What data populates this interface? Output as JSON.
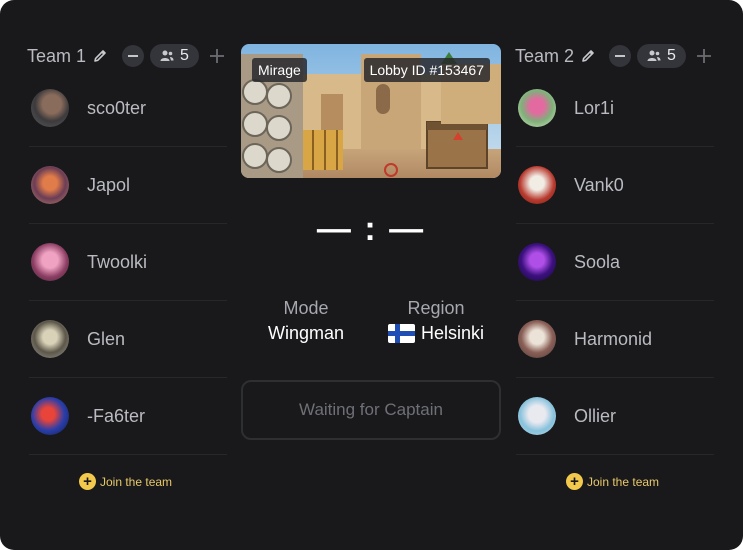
{
  "team1": {
    "title": "Team 1",
    "count": "5",
    "players": [
      "sco0ter",
      "Japol",
      "Twoolki",
      "Glen",
      "-Fa6ter"
    ],
    "join_label": "Join the team"
  },
  "team2": {
    "title": "Team 2",
    "count": "5",
    "players": [
      "Lor1i",
      "Vank0",
      "Soola",
      "Harmonid",
      "Ollier"
    ],
    "join_label": "Join the team"
  },
  "map": {
    "name": "Mirage",
    "lobby_id": "Lobby ID #153467"
  },
  "score": {
    "left": "—",
    "sep": ":",
    "right": "—"
  },
  "mode": {
    "label": "Mode",
    "value": "Wingman"
  },
  "region": {
    "label": "Region",
    "value": "Helsinki"
  },
  "status_text": "Waiting for Captain",
  "icons": {
    "edit": "pencil-icon",
    "decrease": "minus-icon",
    "players": "users-icon",
    "increase": "plus-icon",
    "join": "plus-circle-icon",
    "flag": "finland-flag-icon"
  },
  "colors": {
    "accent": "#f2c94c",
    "background": "#19191b",
    "pill": "#33353a"
  }
}
